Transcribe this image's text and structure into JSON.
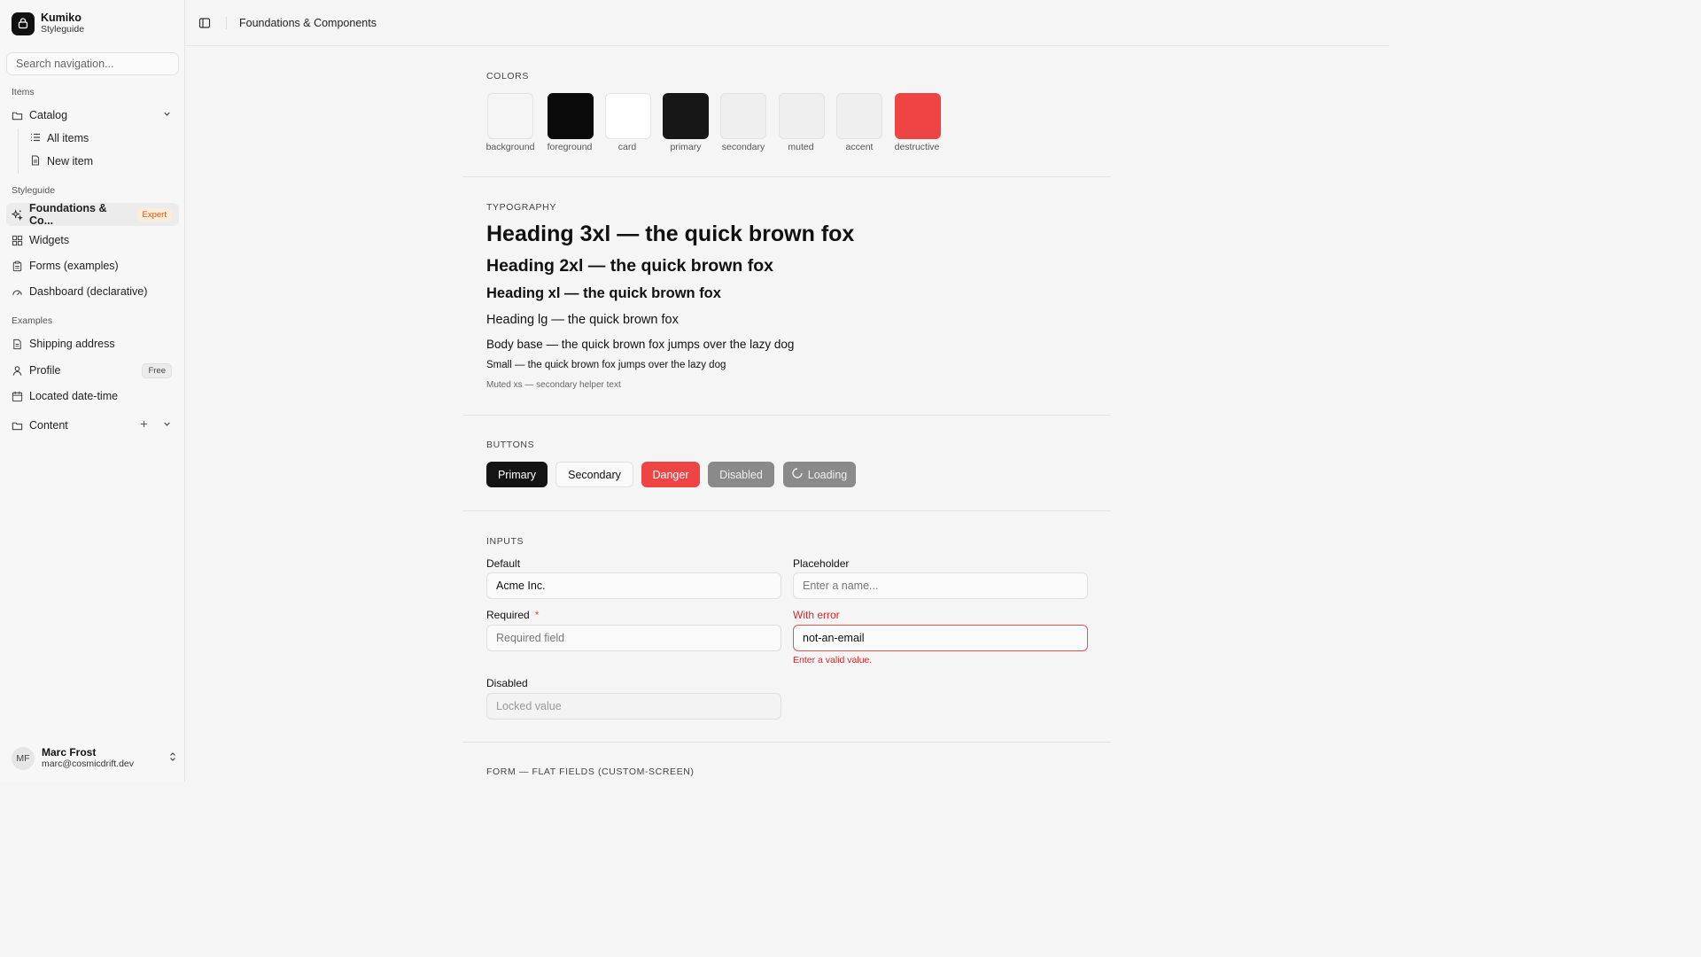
{
  "brand": {
    "name": "Kumiko",
    "subtitle": "Styleguide"
  },
  "search": {
    "placeholder": "Search navigation..."
  },
  "sidebar": {
    "groups": [
      {
        "label": "Items"
      },
      {
        "label": "Styleguide"
      },
      {
        "label": "Examples"
      }
    ],
    "catalog": {
      "label": "Catalog",
      "children": [
        {
          "label": "All items"
        },
        {
          "label": "New item"
        }
      ]
    },
    "styleguide_items": [
      {
        "label": "Foundations & Co...",
        "badge": "Expert"
      },
      {
        "label": "Widgets"
      },
      {
        "label": "Forms (examples)"
      },
      {
        "label": "Dashboard (declarative)"
      }
    ],
    "example_items": [
      {
        "label": "Shipping address"
      },
      {
        "label": "Profile",
        "badge": "Free"
      },
      {
        "label": "Located date-time"
      }
    ],
    "content": {
      "label": "Content"
    }
  },
  "user": {
    "initials": "MF",
    "name": "Marc Frost",
    "email": "marc@cosmicdrift.dev"
  },
  "header": {
    "title": "Foundations & Components"
  },
  "sections": {
    "colors": "COLORS",
    "typography": "TYPOGRAPHY",
    "buttons": "BUTTONS",
    "inputs": "INPUTS",
    "form": "FORM — FLAT FIELDS (CUSTOM-SCREEN)"
  },
  "colors": [
    {
      "name": "background",
      "hex": "#f5f5f5"
    },
    {
      "name": "foreground",
      "hex": "#0a0a0a"
    },
    {
      "name": "card",
      "hex": "#ffffff"
    },
    {
      "name": "primary",
      "hex": "#171717"
    },
    {
      "name": "secondary",
      "hex": "#efefef"
    },
    {
      "name": "muted",
      "hex": "#efefef"
    },
    {
      "name": "accent",
      "hex": "#efefef"
    },
    {
      "name": "destructive",
      "hex": "#ef4444"
    }
  ],
  "typography": {
    "h3xl": "Heading 3xl — the quick brown fox",
    "h2xl": "Heading 2xl — the quick brown fox",
    "hxl": "Heading xl — the quick brown fox",
    "hlg": "Heading lg — the quick brown fox",
    "body": "Body base — the quick brown fox jumps over the lazy dog",
    "small": "Small — the quick brown fox jumps over the lazy dog",
    "muted": "Muted xs — secondary helper text"
  },
  "buttons": {
    "primary": "Primary",
    "secondary": "Secondary",
    "danger": "Danger",
    "disabled": "Disabled",
    "loading": "Loading"
  },
  "inputs": {
    "default": {
      "label": "Default",
      "value": "Acme Inc."
    },
    "placeholder": {
      "label": "Placeholder",
      "placeholder": "Enter a name..."
    },
    "required": {
      "label": "Required",
      "marker": "*",
      "placeholder": "Required field"
    },
    "error": {
      "label": "With error",
      "value": "not-an-email",
      "message": "Enter a valid value."
    },
    "disabled": {
      "label": "Disabled",
      "placeholder": "Locked value"
    }
  }
}
